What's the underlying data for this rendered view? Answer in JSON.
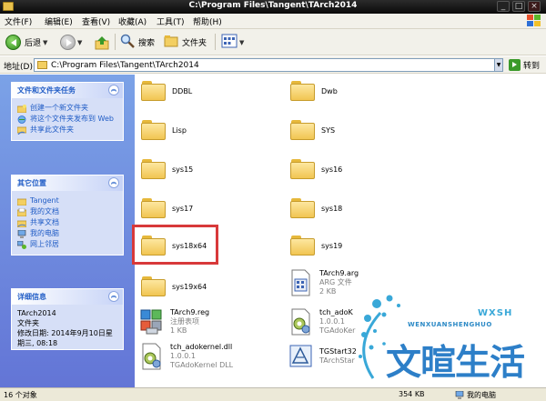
{
  "window": {
    "title": "C:\\Program Files\\Tangent\\TArch2014"
  },
  "menu": [
    "文件(F)",
    "编辑(E)",
    "查看(V)",
    "收藏(A)",
    "工具(T)",
    "帮助(H)"
  ],
  "toolbar": {
    "back": "后退",
    "search": "搜索",
    "folders": "文件夹"
  },
  "address": {
    "label": "地址(D)",
    "value": "C:\\Program Files\\Tangent\\TArch2014",
    "go": "转到"
  },
  "tasks": {
    "title": "文件和文件夹任务",
    "items": [
      "创建一个新文件夹",
      "将这个文件夹发布到 Web",
      "共享此文件夹"
    ]
  },
  "places": {
    "title": "其它位置",
    "items": [
      "Tangent",
      "我的文档",
      "共享文档",
      "我的电脑",
      "网上邻居"
    ]
  },
  "details": {
    "title": "详细信息",
    "name": "TArch2014",
    "type": "文件夹",
    "modified": "修改日期: 2014年9月10日星期三, 08:18"
  },
  "files": {
    "f1": "DDBL",
    "f2": "Dwb",
    "f3": "Lisp",
    "f4": "SYS",
    "f5": "sys15",
    "f6": "sys16",
    "f7": "sys17",
    "f8": "sys18",
    "f9": "sys18x64",
    "f10": "sys19",
    "f11": "sys19x64",
    "arg": {
      "name": "TArch9.arg",
      "type": "ARG 文件",
      "size": "2 KB"
    },
    "reg": {
      "name": "TArch9.reg",
      "type": "注册表项",
      "size": "1 KB"
    },
    "tch": {
      "name": "tch_adoK",
      "ver": "1.0.0.1",
      "desc": "TGAdoKer"
    },
    "dll": {
      "name": "tch_adokernel.dll",
      "ver": "1.0.0.1",
      "desc": "TGAdoKernel DLL"
    },
    "tgs": {
      "name": "TGStart32",
      "desc": "TArchStar"
    }
  },
  "status": {
    "count": "16 个对象",
    "size": "354 KB",
    "location": "我的电脑"
  },
  "watermark": {
    "latin": "WENXUANSHENGHUO",
    "cn": "文暄生活",
    "mark": "WXSH"
  },
  "colors": {
    "highlight_box": "#d8393a",
    "link": "#215dc6"
  }
}
